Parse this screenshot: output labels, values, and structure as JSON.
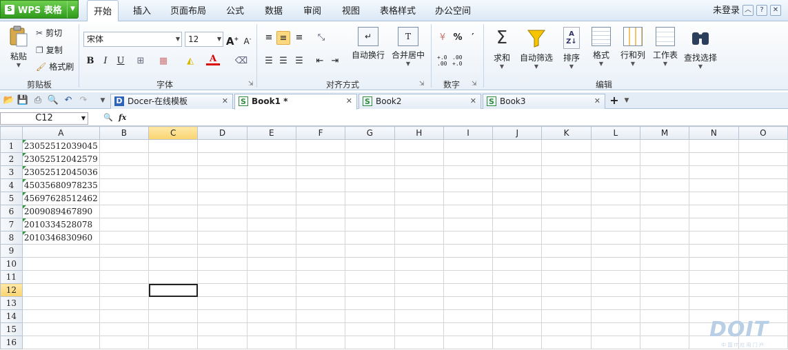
{
  "app": {
    "title": "WPS 表格"
  },
  "menu": {
    "tabs": [
      "开始",
      "插入",
      "页面布局",
      "公式",
      "数据",
      "审阅",
      "视图",
      "表格样式",
      "办公空间"
    ],
    "active": "开始"
  },
  "user": {
    "login": "未登录"
  },
  "ribbon": {
    "clipboard": {
      "paste": "粘贴",
      "cut": "剪切",
      "copy": "复制",
      "format_painter": "格式刷",
      "label": "剪贴板"
    },
    "font": {
      "name": "宋体",
      "size": "12",
      "label": "字体",
      "bold": "B",
      "italic": "I",
      "underline": "U"
    },
    "align": {
      "wrap": "自动换行",
      "merge": "合并居中",
      "label": "对齐方式"
    },
    "number": {
      "percent": "%",
      "comma": "′",
      "inc": "+.0\n.00",
      "dec": ".00\n+.0",
      "label": "数字"
    },
    "edit": {
      "sum": "求和",
      "filter": "自动筛选",
      "sort": "排序",
      "format": "格式",
      "rowcol": "行和列",
      "sheet": "工作表",
      "find": "查找选择",
      "label": "编辑"
    }
  },
  "tabs": [
    {
      "name": "Docer-在线模板",
      "icon": "D"
    },
    {
      "name": "Book1 *",
      "icon": "S",
      "active": true
    },
    {
      "name": "Book2",
      "icon": "S"
    },
    {
      "name": "Book3",
      "icon": "S"
    }
  ],
  "formula": {
    "cell_ref": "C12",
    "fx": "fx",
    "value": ""
  },
  "columns": [
    "A",
    "B",
    "C",
    "D",
    "E",
    "F",
    "G",
    "H",
    "I",
    "J",
    "K",
    "L",
    "M",
    "N",
    "O"
  ],
  "selected_col": "C",
  "selected_row": 12,
  "rows": [
    {
      "n": 1,
      "a": "23052512039045"
    },
    {
      "n": 2,
      "a": "23052512042579"
    },
    {
      "n": 3,
      "a": "23052512045036"
    },
    {
      "n": 4,
      "a": "45035680978235"
    },
    {
      "n": 5,
      "a": "45697628512462"
    },
    {
      "n": 6,
      "a": "2009089467890"
    },
    {
      "n": 7,
      "a": "2010334528078"
    },
    {
      "n": 8,
      "a": "2010346830960"
    },
    {
      "n": 9,
      "a": ""
    },
    {
      "n": 10,
      "a": ""
    },
    {
      "n": 11,
      "a": ""
    },
    {
      "n": 12,
      "a": ""
    },
    {
      "n": 13,
      "a": ""
    },
    {
      "n": 14,
      "a": ""
    },
    {
      "n": 15,
      "a": ""
    },
    {
      "n": 16,
      "a": ""
    }
  ],
  "watermark": {
    "logo": "DOIT",
    "sub": "中 国 IT 应 用 门 户"
  }
}
